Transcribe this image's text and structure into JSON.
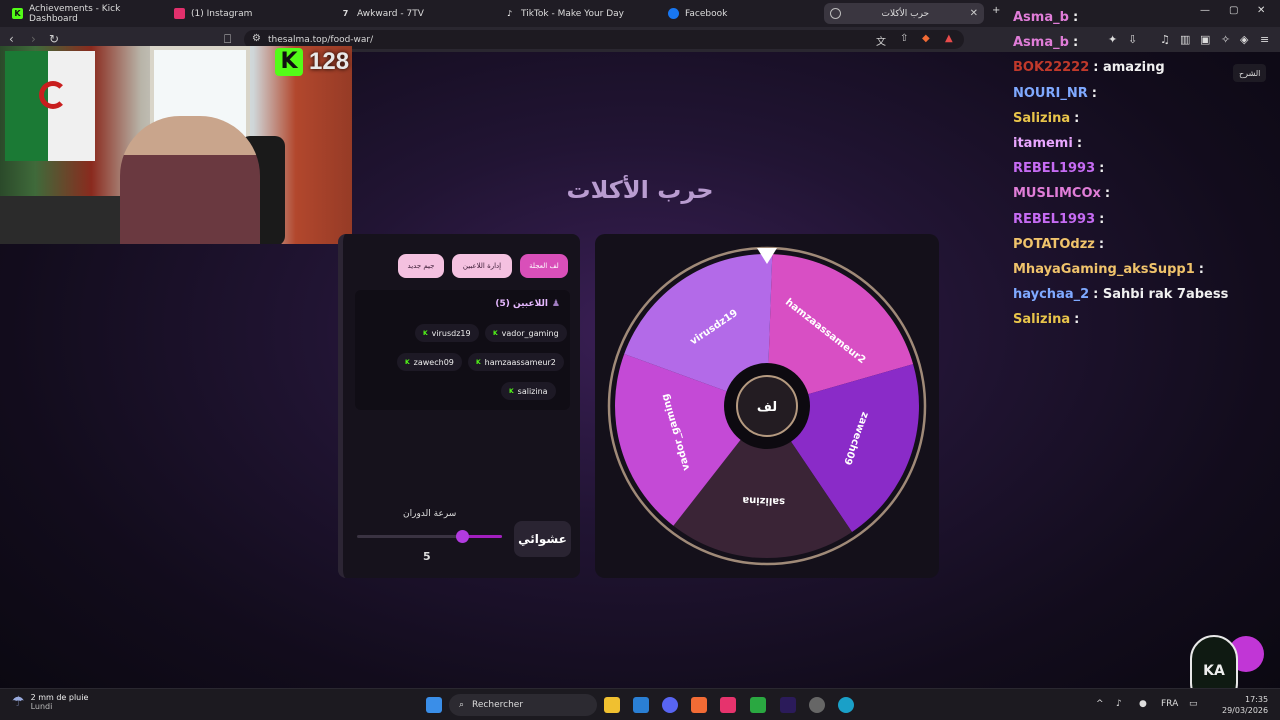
{
  "browser": {
    "tabs": [
      {
        "label": "Achievements - Kick Dashboard",
        "icon": "kick-icon",
        "color": "#53fc18"
      },
      {
        "label": "(1) Instagram",
        "icon": "instagram-icon",
        "color": "#e1306c"
      },
      {
        "label": "Awkward - 7TV",
        "icon": "7tv-icon",
        "color": "#dddddd"
      },
      {
        "label": "TikTok - Make Your Day",
        "icon": "tiktok-icon",
        "color": "#ffffff"
      },
      {
        "label": "Facebook",
        "icon": "facebook-icon",
        "color": "#1877f2"
      },
      {
        "label": "حرب الأكلات",
        "icon": "globe-icon",
        "color": "#bbbbbb",
        "active": true
      }
    ],
    "url": "thesalma.top/food-war/"
  },
  "stream": {
    "viewer_count": "128"
  },
  "page": {
    "title": "حرب الأكلات",
    "buttons": {
      "spin": "لف العجلة",
      "manage_players": "إدارة اللاعبين",
      "new_game": "جيم جديد"
    },
    "players_title": "اللاعبين (5)",
    "players": [
      "virusdz19",
      "vador_gaming",
      "zawech09",
      "hamzaassameur2",
      "salizina"
    ],
    "speed_label": "سرعة الدوران",
    "speed_value": "5",
    "speed_fraction": 0.85,
    "random_button": "عشوائي",
    "spin_center": "لف"
  },
  "wheel": {
    "segments": [
      {
        "name": "hamzaassameur2",
        "color": "#d84fc4"
      },
      {
        "name": "zawech09",
        "color": "#8a2bc8"
      },
      {
        "name": "salizina",
        "color": "#3a2436"
      },
      {
        "name": "vador_gaming",
        "color": "#c44ad6"
      },
      {
        "name": "virusdz19",
        "color": "#b36ae8"
      }
    ]
  },
  "chat": {
    "explain_label": "الشرح",
    "messages": [
      {
        "user": "Asma_b",
        "user_color": "#e07dd8",
        "text": ":"
      },
      {
        "user": "Asma_b",
        "user_color": "#e07dd8",
        "text": ":"
      },
      {
        "user": "BOK22222",
        "user_color": "#c0392b",
        "text": ": amazing"
      },
      {
        "user": "NOURI_NR",
        "user_color": "#7fa9ff",
        "text": ":"
      },
      {
        "user": "Salizina",
        "user_color": "#e8c44a",
        "text": ":"
      },
      {
        "user": "itamemi",
        "user_color": "#e9a6ff",
        "text": ":"
      },
      {
        "user": "REBEL1993",
        "user_color": "#c66bf3",
        "text": ":"
      },
      {
        "user": "MUSLIMCOx",
        "user_color": "#e07dd8",
        "text": ":"
      },
      {
        "user": "REBEL1993",
        "user_color": "#c66bf3",
        "text": ":"
      },
      {
        "user": "POTATOdzz",
        "user_color": "#f0c36b",
        "text": ":"
      },
      {
        "user": "MhayaGaming_aksSupp1",
        "user_color": "#f0c36b",
        "text": ":"
      },
      {
        "user": "haychaa_2",
        "user_color": "#7fa9ff",
        "text": ": Sahbi rak 7abess"
      },
      {
        "user": "Salizina",
        "user_color": "#e8c44a",
        "text": ":"
      }
    ]
  },
  "taskbar": {
    "weather_line1": "2 mm de pluie",
    "weather_line2": "Lundi",
    "search_label": "Rechercher",
    "language": "FRA",
    "time": "17:35",
    "date": "29/03/2026"
  }
}
